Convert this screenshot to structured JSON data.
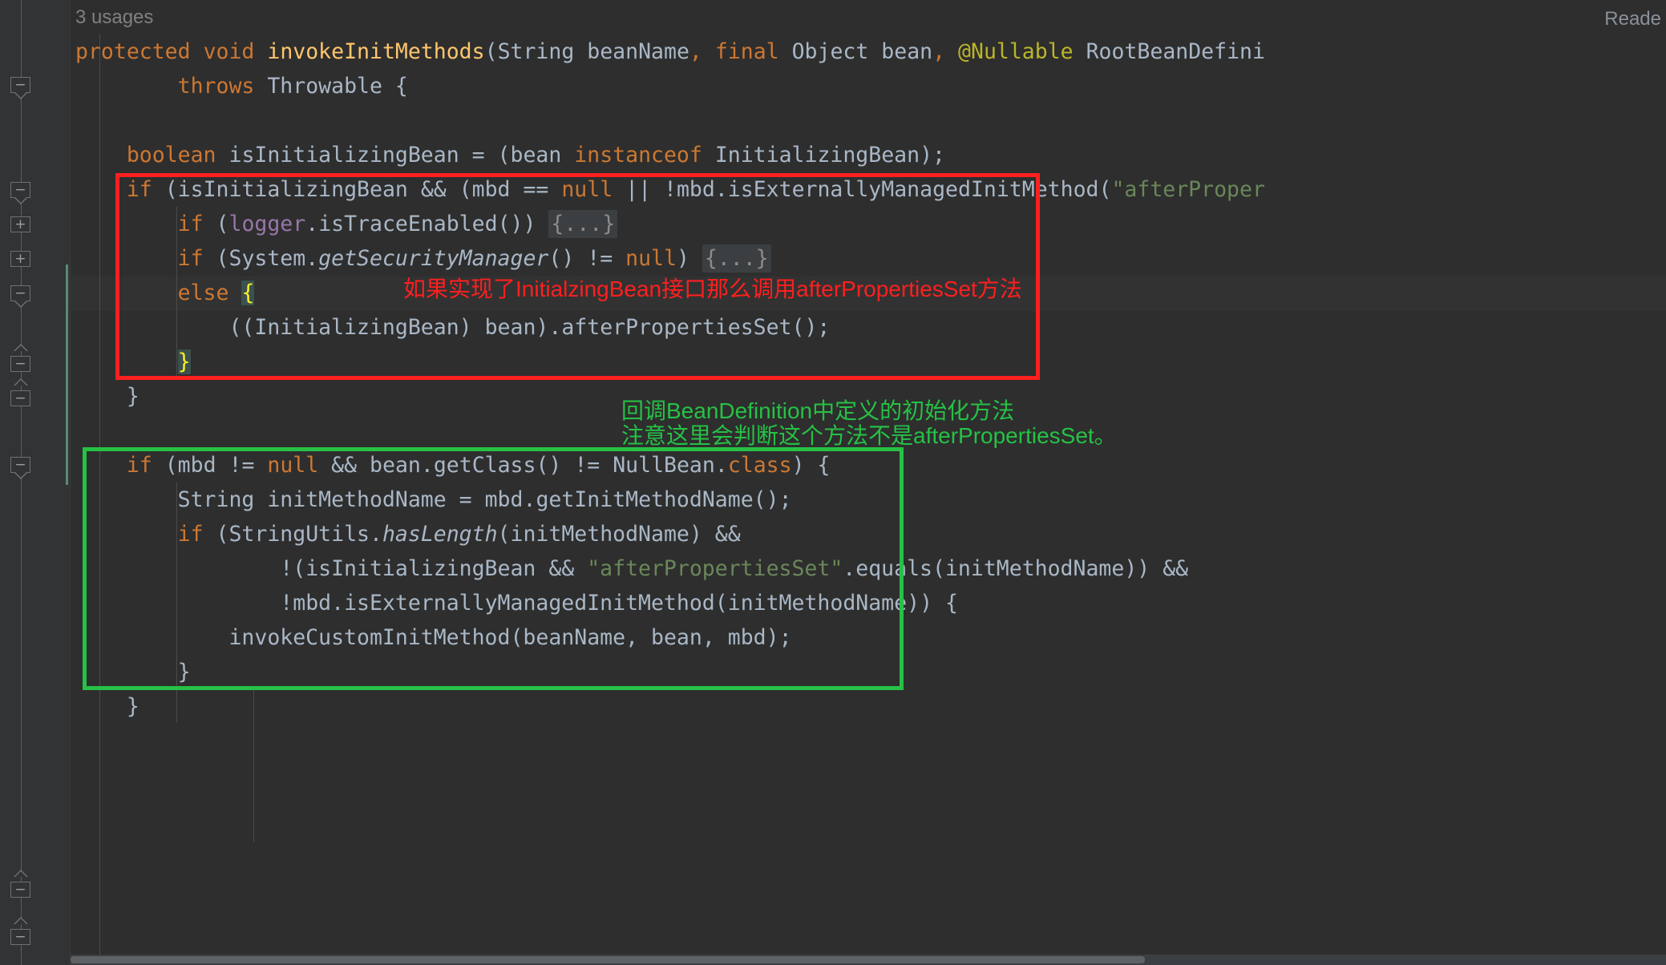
{
  "editor": {
    "theme": "darcula",
    "background": "#2e2e2e",
    "gutter_background": "#313335",
    "usages_hint": "3 usages",
    "reader_mode_label": "Reade",
    "annotation_colors": {
      "red": "#ff1f1f",
      "green": "#26c145"
    }
  },
  "code_lines": [
    {
      "id": "l1",
      "text": "protected void invokeInitMethods(String beanName, final Object bean, @Nullable RootBeanDefini"
    },
    {
      "id": "l2",
      "text": "        throws Throwable {"
    },
    {
      "id": "l3",
      "text": ""
    },
    {
      "id": "l4",
      "text": "    boolean isInitializingBean = (bean instanceof InitializingBean);"
    },
    {
      "id": "l5",
      "text": "    if (isInitializingBean && (mbd == null || !mbd.isExternallyManagedInitMethod(\"afterProper"
    },
    {
      "id": "l6",
      "text": "        if (logger.isTraceEnabled()) {...}"
    },
    {
      "id": "l7",
      "text": "        if (System.getSecurityManager() != null) {...}"
    },
    {
      "id": "l8",
      "text": "        else {"
    },
    {
      "id": "l9",
      "text": "            ((InitializingBean) bean).afterPropertiesSet();"
    },
    {
      "id": "l10",
      "text": "        }"
    },
    {
      "id": "l11",
      "text": "    }"
    },
    {
      "id": "l12",
      "text": ""
    },
    {
      "id": "l13",
      "text": ""
    },
    {
      "id": "l14",
      "text": "    if (mbd != null && bean.getClass() != NullBean.class) {"
    },
    {
      "id": "l15",
      "text": "        String initMethodName = mbd.getInitMethodName();"
    },
    {
      "id": "l16",
      "text": "        if (StringUtils.hasLength(initMethodName) &&"
    },
    {
      "id": "l17",
      "text": "                !(isInitializingBean && \"afterPropertiesSet\".equals(initMethodName)) &&"
    },
    {
      "id": "l18",
      "text": "                !mbd.isExternallyManagedInitMethod(initMethodName)) {"
    },
    {
      "id": "l19",
      "text": "            invokeCustomInitMethod(beanName, bean, mbd);"
    },
    {
      "id": "l20",
      "text": "        }"
    },
    {
      "id": "l21",
      "text": "    }"
    }
  ],
  "tokens": {
    "kw_protected": "protected",
    "kw_void": "void",
    "method_name": "invokeInitMethods",
    "type_String": "String",
    "param_beanName": "beanName",
    "kw_final": "final",
    "type_Object": "Object",
    "param_bean": "bean",
    "annotation_nullable": "@Nullable",
    "type_RootBeanDefinition": "RootBeanDefini",
    "kw_throws": "throws",
    "type_Throwable": "Throwable",
    "kw_boolean": "boolean",
    "var_isInitializingBean": "isInitializingBean",
    "kw_instanceof": "instanceof",
    "type_InitializingBean": "InitializingBean",
    "kw_if": "if",
    "var_mbd": "mbd",
    "kw_null": "null",
    "mth_isExternallyManagedInitMethod": "isExternallyManagedInitMethod",
    "str_afterProperties": "\"afterProper",
    "fld_logger": "logger",
    "mth_isTraceEnabled": "isTraceEnabled",
    "folded_placeholder": "{...}",
    "type_System": "System",
    "mth_getSecurityManager": "getSecurityManager",
    "kw_else": "else",
    "mth_afterPropertiesSet": "afterPropertiesSet",
    "mth_getClass": "getClass",
    "type_NullBean": "NullBean",
    "kw_class": "class",
    "var_initMethodName": "initMethodName",
    "mth_getInitMethodName": "getInitMethodName",
    "type_StringUtils": "StringUtils",
    "mth_hasLength": "hasLength",
    "str_afterPropertiesSet": "\"afterPropertiesSet\"",
    "mth_equals": "equals",
    "mth_invokeCustomInitMethod": "invokeCustomInitMethod",
    "brace_close": "}"
  },
  "annotations": {
    "red_note": "如果实现了InitialzingBean接口那么调用afterPropertiesSet方法",
    "green_note_line1": "回调BeanDefinition中定义的初始化方法",
    "green_note_line2": "注意这里会判断这个方法不是afterPropertiesSet。"
  },
  "gutter": {
    "fold_markers": [
      {
        "id": "fm1",
        "state": "collapse",
        "direction": "down",
        "glyph": "−"
      },
      {
        "id": "fm2",
        "state": "collapse",
        "direction": "down",
        "glyph": "−"
      },
      {
        "id": "fm3",
        "state": "expand",
        "direction": "none",
        "glyph": "+"
      },
      {
        "id": "fm4",
        "state": "expand",
        "direction": "none",
        "glyph": "+"
      },
      {
        "id": "fm5",
        "state": "collapse",
        "direction": "down",
        "glyph": "−"
      },
      {
        "id": "fm6",
        "state": "collapse",
        "direction": "up",
        "glyph": "−"
      },
      {
        "id": "fm7",
        "state": "collapse",
        "direction": "up",
        "glyph": "−"
      },
      {
        "id": "fm8",
        "state": "collapse",
        "direction": "down",
        "glyph": "−"
      },
      {
        "id": "fm9",
        "state": "collapse",
        "direction": "up",
        "glyph": "−"
      },
      {
        "id": "fm10",
        "state": "collapse",
        "direction": "up",
        "glyph": "−"
      }
    ]
  }
}
